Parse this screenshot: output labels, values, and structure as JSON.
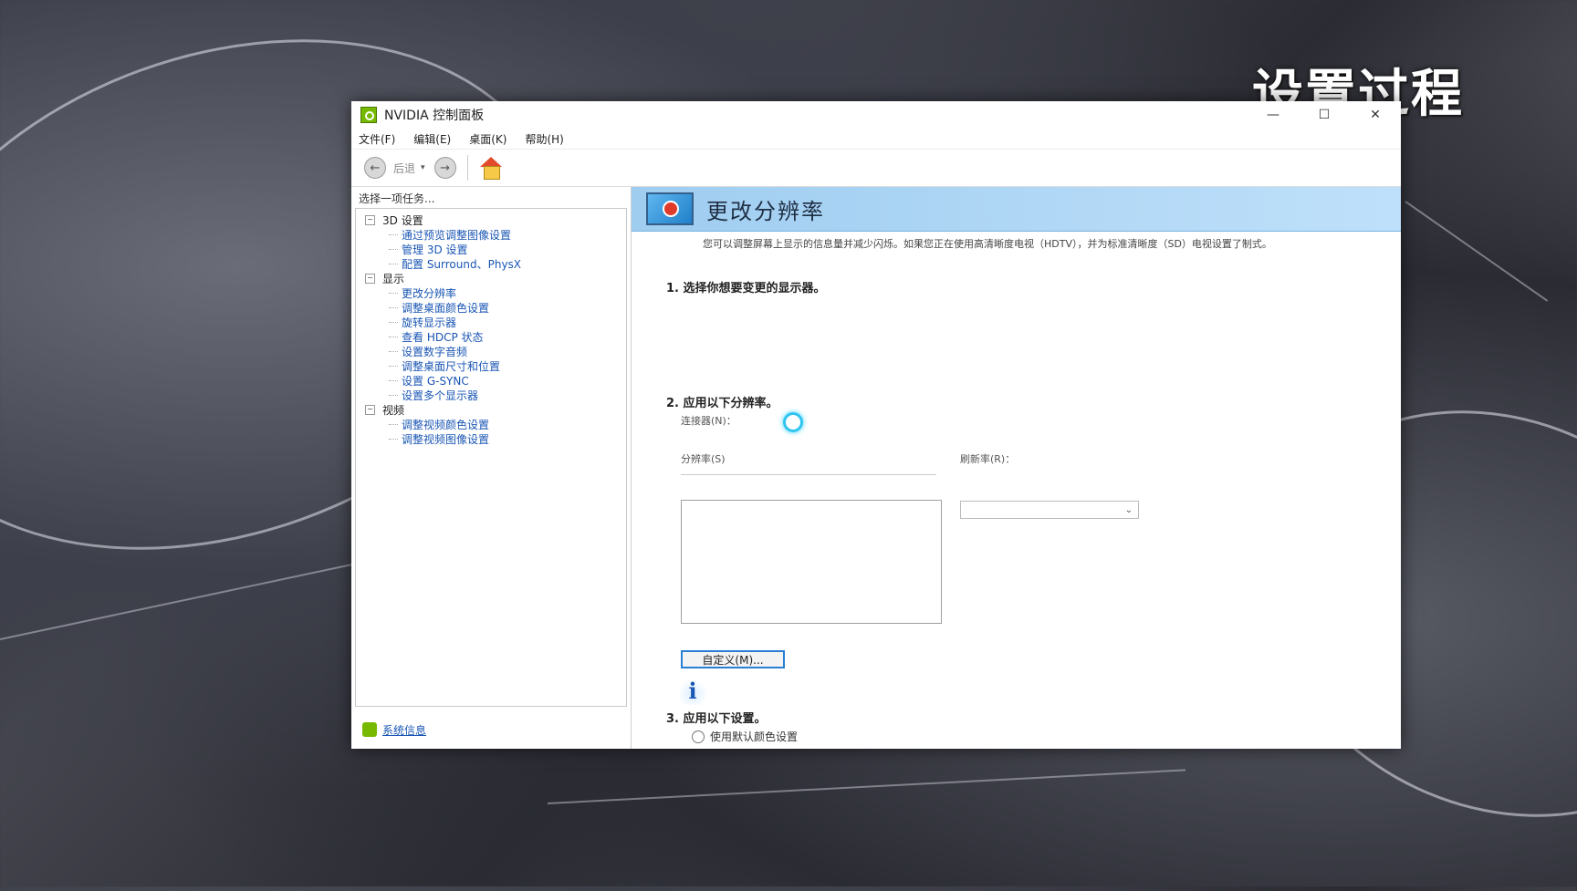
{
  "overlay": {
    "title": "设置过程"
  },
  "window": {
    "title": "NVIDIA 控制面板",
    "controls": {
      "minimize": "—",
      "maximize": "☐",
      "close": "✕"
    }
  },
  "menubar": {
    "items": [
      "文件(F)",
      "编辑(E)",
      "桌面(K)",
      "帮助(H)"
    ]
  },
  "toolbar": {
    "back_label": "后退",
    "dropdown_glyph": "▾",
    "back_glyph": "←",
    "forward_glyph": "→"
  },
  "left_pane": {
    "heading": "选择一项任务...",
    "categories": [
      {
        "label": "3D 设置",
        "expander": "−",
        "items": [
          "通过预览调整图像设置",
          "管理 3D 设置",
          "配置 Surround、PhysX"
        ]
      },
      {
        "label": "显示",
        "expander": "−",
        "items": [
          "更改分辨率",
          "调整桌面颜色设置",
          "旋转显示器",
          "查看 HDCP 状态",
          "设置数字音频",
          "调整桌面尺寸和位置",
          "设置 G-SYNC",
          "设置多个显示器"
        ]
      },
      {
        "label": "视频",
        "expander": "−",
        "items": [
          "调整视频颜色设置",
          "调整视频图像设置"
        ]
      }
    ],
    "system_info": "系统信息"
  },
  "right_pane": {
    "banner_title": "更改分辨率",
    "description": "您可以调整屏幕上显示的信息量并减少闪烁。如果您正在使用高清晰度电视（HDTV），并为标准清晰度（SD）电视设置了制式。",
    "step1": "1.  选择你想要变更的显示器。",
    "step2": "2.  应用以下分辨率。",
    "connector_label": "连接器(N)：",
    "resolution_label": "分辨率(S)",
    "refresh_label": "刷新率(R)：",
    "refresh_arrow": "⌄",
    "custom_button": "自定义(M)...",
    "info_glyph": "i",
    "step3": "3.  应用以下设置。",
    "radio_default_color": "使用默认颜色设置"
  }
}
